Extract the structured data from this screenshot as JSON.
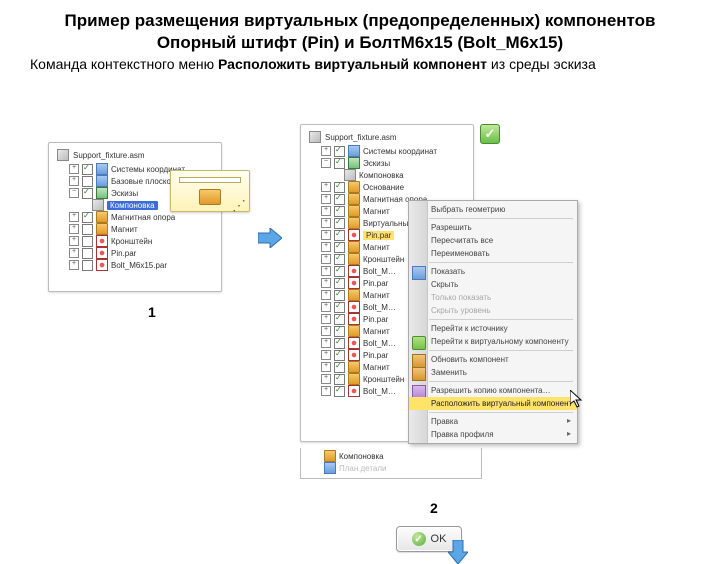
{
  "title_line1": "Пример размещения виртуальных (предопределенных) компонентов Опорный штифт (Pin) и БолтМ6х15 (Bolt_M6x15)",
  "subtitle_pre": "Команда контекстного меню ",
  "subtitle_bold": "Расположить виртуальный компонент",
  "subtitle_post": " из среды эскиза",
  "caption1": "1",
  "caption2": "2",
  "ok_label": "OK",
  "panel1": {
    "asm": "Support_fixture.asm",
    "items": [
      {
        "chk": true,
        "label": "Системы координат",
        "ico": "blue"
      },
      {
        "chk": false,
        "label": "Базовые плоскости",
        "ico": "blue"
      },
      {
        "chk": true,
        "label": "Эскизы",
        "ico": "green",
        "expanded": true,
        "children": [
          {
            "label": "Компоновка",
            "selected": "blue"
          }
        ]
      },
      {
        "chk": true,
        "label": "Магнитная опора",
        "ico": "cmp"
      },
      {
        "chk": false,
        "label": "Магнит",
        "ico": "cmp"
      },
      {
        "chk": false,
        "label": "Кронштейн",
        "ico": "red"
      },
      {
        "chk": false,
        "label": "Pin.par",
        "ico": "red"
      },
      {
        "chk": false,
        "label": "Bolt_M6x15.par",
        "ico": "red"
      }
    ]
  },
  "panel2": {
    "asm": "Support_fixture.asm",
    "items": [
      {
        "chk": true,
        "label": "Системы координат",
        "ico": "blue"
      },
      {
        "chk": true,
        "label": "Эскизы",
        "ico": "green",
        "expanded": true,
        "children": [
          {
            "label": "Компоновка"
          }
        ]
      },
      {
        "chk": true,
        "label": "Основание",
        "ico": "cmp"
      },
      {
        "chk": true,
        "label": "Магнитная опора",
        "ico": "cmp"
      },
      {
        "chk": true,
        "label": "Магнит",
        "ico": "cmp"
      },
      {
        "chk": true,
        "label": "Виртуальный штырь",
        "ico": "cmp"
      },
      {
        "chk": true,
        "label": "Pin.par",
        "ico": "red",
        "selected": "yellow"
      },
      {
        "chk": true,
        "label": "Магнит",
        "ico": "cmp"
      },
      {
        "chk": true,
        "label": "Кронштейн",
        "ico": "cmp"
      },
      {
        "chk": true,
        "label": "Bolt_M…",
        "ico": "red"
      },
      {
        "chk": true,
        "label": "Pin.par",
        "ico": "red"
      },
      {
        "chk": true,
        "label": "Магнит",
        "ico": "cmp"
      },
      {
        "chk": true,
        "label": "Bolt_M…",
        "ico": "red"
      },
      {
        "chk": true,
        "label": "Pin.par",
        "ico": "red"
      },
      {
        "chk": true,
        "label": "Магнит",
        "ico": "cmp"
      },
      {
        "chk": true,
        "label": "Bolt_M…",
        "ico": "red"
      },
      {
        "chk": true,
        "label": "Pin.par",
        "ico": "red"
      },
      {
        "chk": true,
        "label": "Магнит",
        "ico": "cmp"
      },
      {
        "chk": true,
        "label": "Кронштейн",
        "ico": "cmp"
      },
      {
        "chk": true,
        "label": "Bolt_M…",
        "ico": "red"
      }
    ],
    "footer": [
      {
        "label": "Компоновка",
        "ico": "cmp"
      },
      {
        "label": "План детали",
        "ico": "blue",
        "dim": true
      }
    ]
  },
  "context_menu": [
    {
      "label": "Выбрать геометрию",
      "type": "item"
    },
    {
      "type": "sep"
    },
    {
      "label": "Разрешить",
      "type": "item"
    },
    {
      "label": "Пересчитать все",
      "type": "item"
    },
    {
      "label": "Переименовать",
      "type": "item"
    },
    {
      "type": "sep"
    },
    {
      "label": "Показать",
      "type": "item",
      "ico": "blue"
    },
    {
      "label": "Скрыть",
      "type": "item"
    },
    {
      "label": "Только показать",
      "type": "disabled"
    },
    {
      "label": "Скрыть уровень",
      "type": "disabled"
    },
    {
      "type": "sep"
    },
    {
      "label": "Перейти к источнику",
      "type": "item"
    },
    {
      "label": "Перейти к виртуальному компоненту",
      "type": "item",
      "ico": "vc"
    },
    {
      "type": "sep"
    },
    {
      "label": "Обновить компонент",
      "type": "item",
      "ico": "re"
    },
    {
      "label": "Заменить",
      "type": "item",
      "ico": "re"
    },
    {
      "type": "sep"
    },
    {
      "label": "Разрешить копию компонента…",
      "type": "item",
      "ico": "purple"
    },
    {
      "label": "Расположить виртуальный компонент",
      "type": "hl"
    },
    {
      "type": "sep"
    },
    {
      "label": "Правка",
      "type": "arrow"
    },
    {
      "label": "Правка профиля",
      "type": "arrow"
    }
  ]
}
